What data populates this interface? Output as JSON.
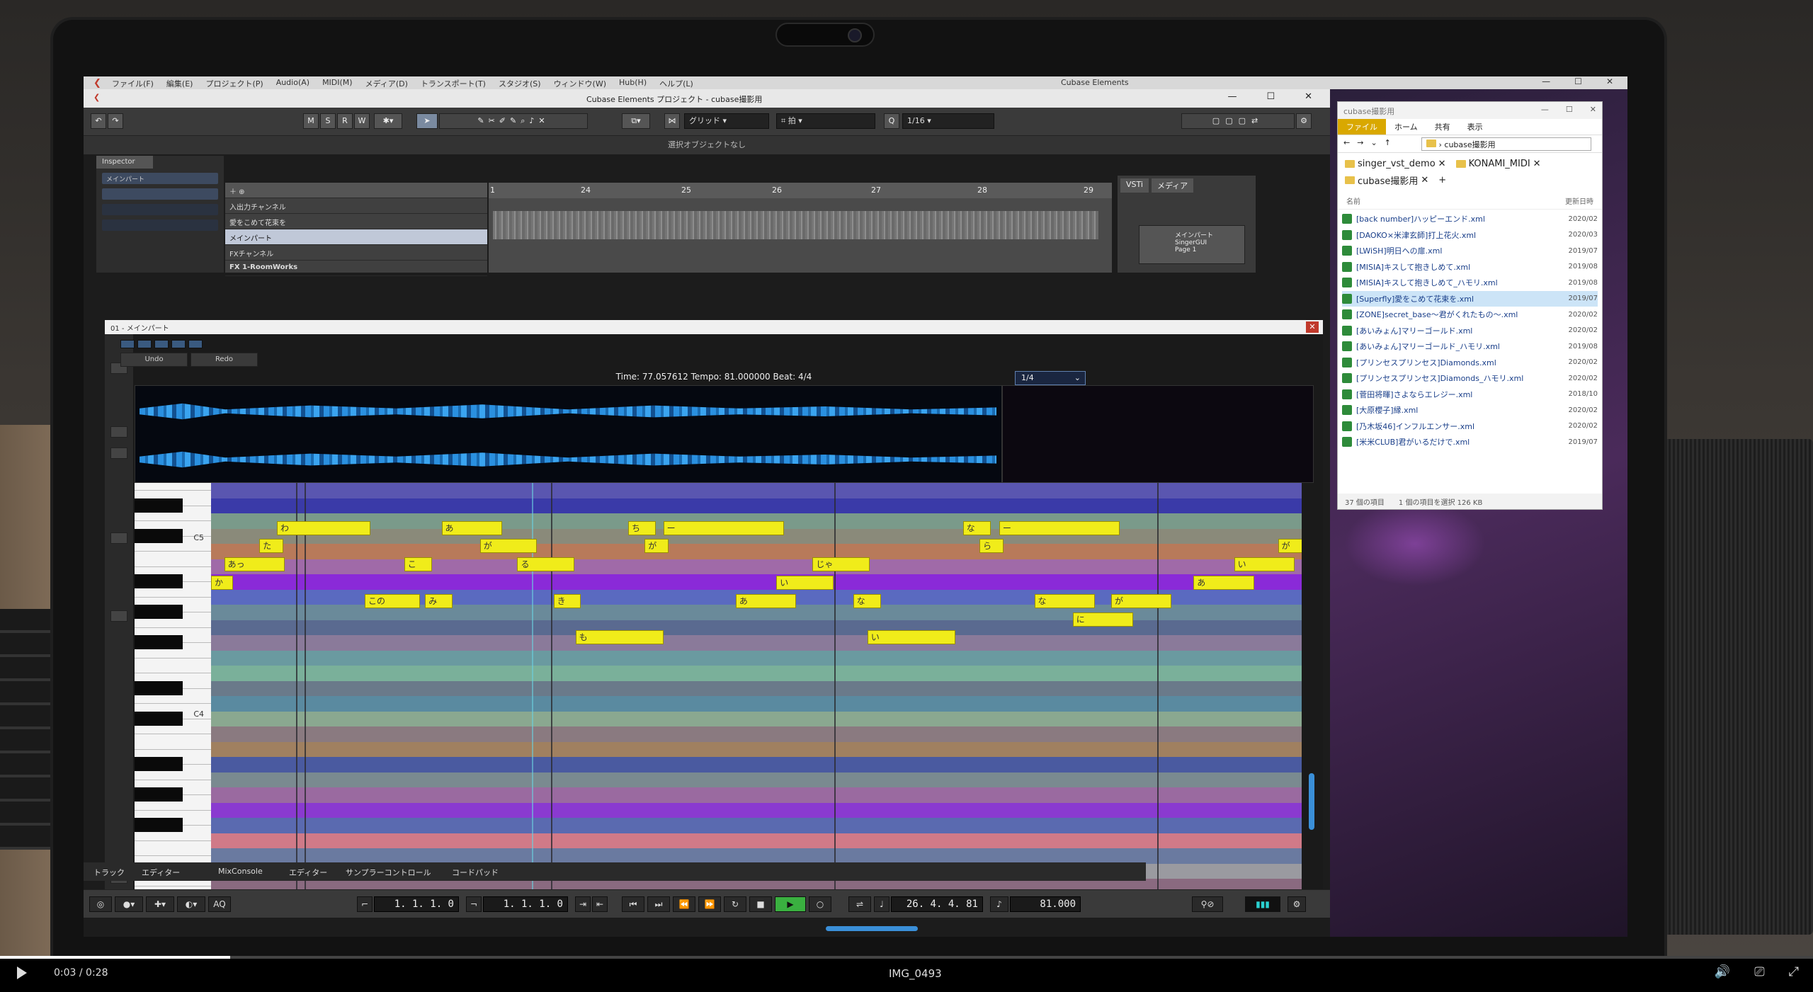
{
  "cubase": {
    "menu": [
      "ファイル(F)",
      "編集(E)",
      "プロジェクト(P)",
      "Audio(A)",
      "MIDI(M)",
      "メディア(D)",
      "トランスポート(T)",
      "スタジオ(S)",
      "ウィンドウ(W)",
      "Hub(H)",
      "ヘルプ(L)"
    ],
    "app_title": "Cubase Elements",
    "project_title": "Cubase Elements プロジェクト - cubase撮影用",
    "toolbar": {
      "m": "M",
      "s": "S",
      "r": "R",
      "w": "W",
      "grid_label": "グリッド",
      "beat_label": "拍",
      "quantize": "1/16"
    },
    "info_line": "選択オブジェクトなし",
    "inspector": {
      "title": "Inspector",
      "track": "メインパート"
    },
    "tracks": {
      "input": "入出力チャンネル",
      "track1": "愛をこめて花束を",
      "track2": "メインパート",
      "fx": "FXチャンネル",
      "fx1": "FX 1-RoomWorks"
    },
    "ruler": [
      "1",
      "24",
      "25",
      "26",
      "27",
      "28",
      "29"
    ],
    "vsti": {
      "tab1": "VSTi",
      "tab2": "メディア",
      "slot_name": "メインパート",
      "plugin": "SingerGUI",
      "page": "Page 1"
    }
  },
  "editor": {
    "title": "01 - メインパート",
    "undo": "Undo",
    "redo": "Redo",
    "status": "Time: 77.057612 Tempo: 81.000000 Beat: 4/4",
    "quant": "1/4",
    "piano_labels": {
      "c5": "C5",
      "c4": "C4"
    },
    "notes": [
      {
        "text": "わ",
        "lane": 2,
        "start": 60,
        "len": 85
      },
      {
        "text": "あ",
        "lane": 2,
        "start": 210,
        "len": 55
      },
      {
        "text": "ち",
        "lane": 2,
        "start": 380,
        "len": 25
      },
      {
        "text": "ー",
        "lane": 2,
        "start": 412,
        "len": 110
      },
      {
        "text": "な",
        "lane": 2,
        "start": 685,
        "len": 25
      },
      {
        "text": "ー",
        "lane": 2,
        "start": 718,
        "len": 110
      },
      {
        "text": "た",
        "lane": 3,
        "start": 44,
        "len": 22
      },
      {
        "text": "が",
        "lane": 3,
        "start": 245,
        "len": 52
      },
      {
        "text": "が",
        "lane": 3,
        "start": 395,
        "len": 22
      },
      {
        "text": "ら",
        "lane": 3,
        "start": 700,
        "len": 22
      },
      {
        "text": "が",
        "lane": 3,
        "start": 972,
        "len": 22
      },
      {
        "text": "あっ",
        "lane": 4,
        "start": 12,
        "len": 55
      },
      {
        "text": "こ",
        "lane": 4,
        "start": 176,
        "len": 25
      },
      {
        "text": "る",
        "lane": 4,
        "start": 279,
        "len": 52
      },
      {
        "text": "じゃ",
        "lane": 4,
        "start": 548,
        "len": 52
      },
      {
        "text": "い",
        "lane": 4,
        "start": 932,
        "len": 55
      },
      {
        "text": "か",
        "lane": 5,
        "start": 0,
        "len": 20
      },
      {
        "text": "い",
        "lane": 5,
        "start": 515,
        "len": 52
      },
      {
        "text": "あ",
        "lane": 5,
        "start": 895,
        "len": 55
      },
      {
        "text": "この",
        "lane": 6,
        "start": 140,
        "len": 50
      },
      {
        "text": "み",
        "lane": 6,
        "start": 195,
        "len": 25
      },
      {
        "text": "き",
        "lane": 6,
        "start": 312,
        "len": 25
      },
      {
        "text": "あ",
        "lane": 6,
        "start": 478,
        "len": 55
      },
      {
        "text": "な",
        "lane": 6,
        "start": 585,
        "len": 25
      },
      {
        "text": "な",
        "lane": 6,
        "start": 750,
        "len": 55
      },
      {
        "text": "が",
        "lane": 6,
        "start": 820,
        "len": 55
      },
      {
        "text": "に",
        "lane": 7,
        "start": 785,
        "len": 55
      },
      {
        "text": "も",
        "lane": 8,
        "start": 332,
        "len": 80
      },
      {
        "text": "い",
        "lane": 8,
        "start": 598,
        "len": 80
      }
    ]
  },
  "lower_zone": {
    "tabs": [
      "トラック",
      "エディター",
      "MixConsole",
      "エディター",
      "サンプラーコントロール",
      "コードパッド"
    ],
    "pos_left": "1. 1. 1.  0",
    "pos_right": "1. 1. 1.  0",
    "position": "26. 4. 4. 81",
    "tempo": "81.000"
  },
  "explorer": {
    "title": "cubase撮影用",
    "ribbon": [
      "ファイル",
      "ホーム",
      "共有",
      "表示"
    ],
    "address": "cubase撮影用",
    "tabs": [
      "singer_vst_demo",
      "KONAMI_MIDI",
      "cubase撮影用"
    ],
    "col_name": "名前",
    "col_date": "更新日時",
    "files": [
      {
        "name": "[back number]ハッピーエンド.xml",
        "date": "2020/02"
      },
      {
        "name": "[DAOKO×米津玄師]打上花火.xml",
        "date": "2020/03"
      },
      {
        "name": "[LWiSH]明日への扉.xml",
        "date": "2019/07"
      },
      {
        "name": "[MISIA]キスして抱きしめて.xml",
        "date": "2019/08"
      },
      {
        "name": "[MISIA]キスして抱きしめて_ハモリ.xml",
        "date": "2019/08"
      },
      {
        "name": "[Superfly]愛をこめて花束を.xml",
        "date": "2019/07"
      },
      {
        "name": "[ZONE]secret_base〜君がくれたもの〜.xml",
        "date": "2020/02"
      },
      {
        "name": "[あいみょん]マリーゴールド.xml",
        "date": "2020/02"
      },
      {
        "name": "[あいみょん]マリーゴールド_ハモリ.xml",
        "date": "2019/08"
      },
      {
        "name": "[プリンセスプリンセス]Diamonds.xml",
        "date": "2020/02"
      },
      {
        "name": "[プリンセスプリンセス]Diamonds_ハモリ.xml",
        "date": "2020/02"
      },
      {
        "name": "[菅田将暉]さよならエレジー.xml",
        "date": "2018/10"
      },
      {
        "name": "[大原櫻子]縁.xml",
        "date": "2020/02"
      },
      {
        "name": "[乃木坂46]インフルエンサー.xml",
        "date": "2020/02"
      },
      {
        "name": "[米米CLUB]君がいるだけで.xml",
        "date": "2019/07"
      }
    ],
    "status_count": "37 個の項目",
    "status_sel": "1 個の項目を選択  126 KB"
  },
  "video": {
    "time": "0:03 / 0:28",
    "filename": "IMG_0493",
    "progress": 0.127
  }
}
